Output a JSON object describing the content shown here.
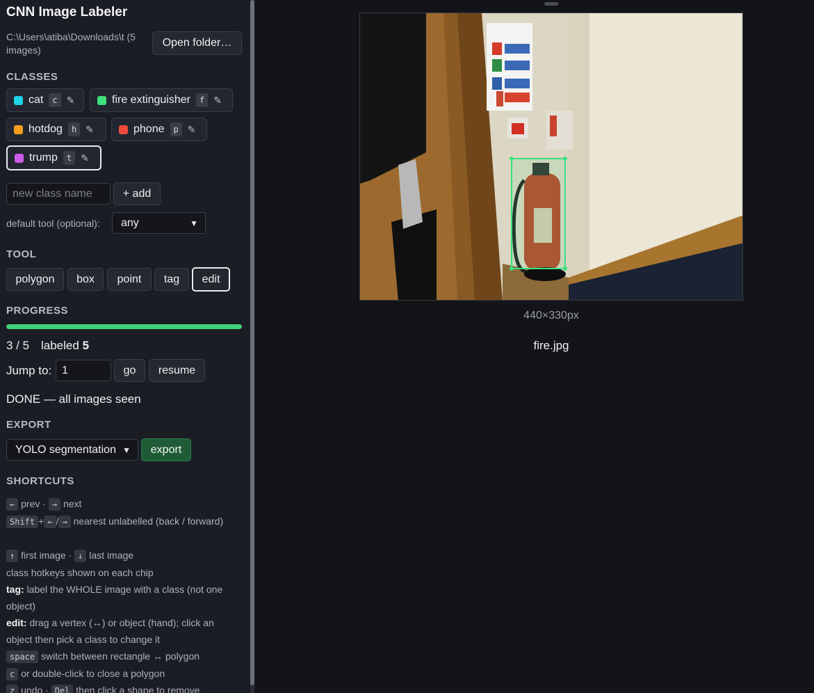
{
  "app": {
    "title": "CNN Image Labeler",
    "folder_path": "C:\\Users\\atiba\\Downloads\\t (5 images)",
    "open_folder_label": "Open folder…"
  },
  "classes": {
    "section_title": "CLASSES",
    "items": [
      {
        "name": "cat",
        "hotkey": "c",
        "color": "#1fd3e6"
      },
      {
        "name": "fire extinguisher",
        "hotkey": "f",
        "color": "#3ee07e"
      },
      {
        "name": "hotdog",
        "hotkey": "h",
        "color": "#f59d1a"
      },
      {
        "name": "phone",
        "hotkey": "p",
        "color": "#ef4a3c"
      },
      {
        "name": "trump",
        "hotkey": "t",
        "color": "#cc5de8"
      }
    ],
    "active": "trump",
    "new_class_placeholder": "new class name",
    "add_label": "+ add",
    "default_tool_label": "default tool (optional):",
    "default_tool_value": "any"
  },
  "tool": {
    "section_title": "TOOL",
    "items": [
      "polygon",
      "box",
      "point",
      "tag",
      "edit"
    ],
    "active": "edit"
  },
  "progress": {
    "section_title": "PROGRESS",
    "fraction": 1.0,
    "count_text": "3 / 5",
    "labeled_label": "labeled",
    "labeled_value": "5",
    "jump_label": "Jump to:",
    "jump_value": "1",
    "go_label": "go",
    "resume_label": "resume",
    "status_text": "DONE — all images seen"
  },
  "export": {
    "section_title": "EXPORT",
    "format_value": "YOLO segmentation",
    "export_label": "export"
  },
  "shortcuts": {
    "section_title": "SHORTCUTS",
    "line1": {
      "k1": "←",
      "t1": "prev ·",
      "k2": "→",
      "t2": "next"
    },
    "line2": {
      "k1": "Shift",
      "plus": "+",
      "k2": "←",
      "slash": "/",
      "k3": "→",
      "t1": "nearest unlabelled (back / forward)"
    },
    "line3": {
      "k1": "↑",
      "t1": "first image ·",
      "k2": "↓",
      "t2": "last image"
    },
    "line4": "class hotkeys shown on each chip",
    "line5": {
      "b": "tag:",
      "t": "label the WHOLE image with a class (not one object)"
    },
    "line6": {
      "b": "edit:",
      "t": "drag a vertex (↔) or object (hand); click an object then pick a class to change it"
    },
    "line7": {
      "k1": "space",
      "t1": "switch between rectangle ↔ polygon"
    },
    "line8": {
      "k1": "c",
      "t1": "or double-click to close a polygon"
    },
    "line9": {
      "k1": "z",
      "t1": "undo ·",
      "k2": "Del",
      "t2": "then click a shape to remove"
    }
  },
  "viewer": {
    "image_size": "440×330px",
    "file_name": "fire.jpg",
    "annotation_color": "#3ee07e"
  }
}
